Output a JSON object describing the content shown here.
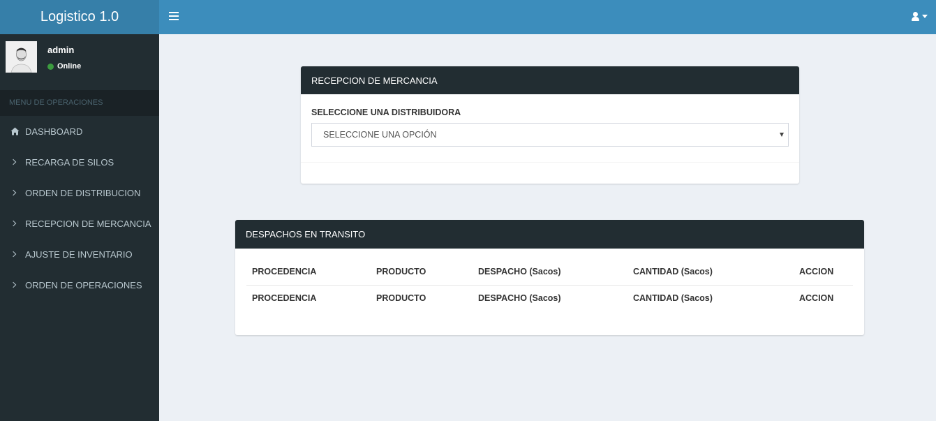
{
  "app": {
    "title": "Logistico 1.0"
  },
  "topbar": {
    "user_menu_icon": "user-icon"
  },
  "user_panel": {
    "username": "admin",
    "status": "Online",
    "status_color": "#3c9b3f"
  },
  "sidebar": {
    "header": "MENU DE OPERACIONES",
    "items": [
      {
        "label": "DASHBOARD",
        "icon": "home-icon"
      },
      {
        "label": "RECARGA DE SILOS",
        "icon": "chevron-right-icon"
      },
      {
        "label": "ORDEN DE DISTRIBUCION",
        "icon": "chevron-right-icon"
      },
      {
        "label": "RECEPCION DE MERCANCIA",
        "icon": "chevron-right-icon"
      },
      {
        "label": "AJUSTE DE INVENTARIO",
        "icon": "chevron-right-icon"
      },
      {
        "label": "ORDEN DE OPERACIONES",
        "icon": "chevron-right-icon"
      }
    ]
  },
  "reception": {
    "title": "RECEPCION DE MERCANCIA",
    "field_label": "SELECCIONE UNA DISTRIBUIDORA",
    "select_value": "SELECCIONE UNA OPCIÓN"
  },
  "dispatches": {
    "title": "DESPACHOS EN TRANSITO",
    "columns": [
      "PROCEDENCIA",
      "PRODUCTO",
      "DESPACHO (Sacos)",
      "CANTIDAD (Sacos)",
      "ACCION"
    ],
    "footer_columns": [
      "PROCEDENCIA",
      "PRODUCTO",
      "DESPACHO (Sacos)",
      "CANTIDAD (Sacos)",
      "ACCION"
    ]
  },
  "colors": {
    "topbar": "#3c8dbc",
    "logo_bg": "#367fa9",
    "sidebar": "#222d32",
    "box_header": "#222d32"
  }
}
